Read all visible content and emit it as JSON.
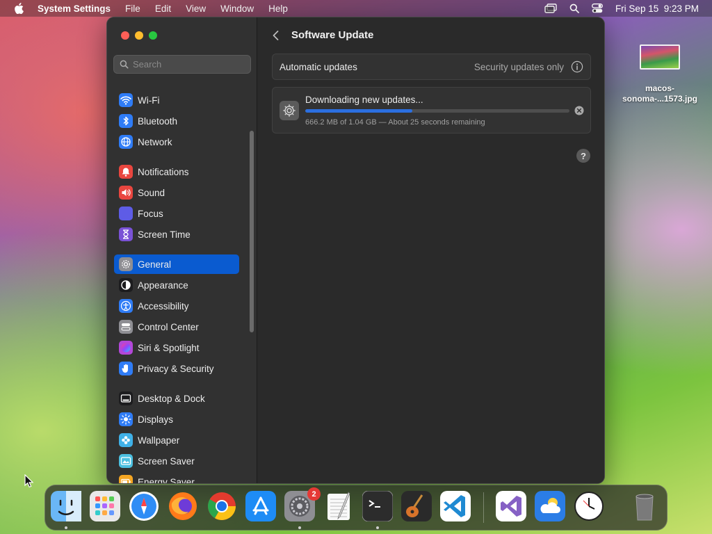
{
  "menubar": {
    "app_name": "System Settings",
    "items": [
      "File",
      "Edit",
      "View",
      "Window",
      "Help"
    ],
    "datetime": "Fri Sep 15  9:23 PM"
  },
  "sidebar": {
    "search_placeholder": "Search",
    "items": [
      {
        "label": "Wi-Fi",
        "icon": "wifi-icon",
        "color": "#2f7cf6"
      },
      {
        "label": "Bluetooth",
        "icon": "bluetooth-icon",
        "color": "#2f7cf6"
      },
      {
        "label": "Network",
        "icon": "globe-icon",
        "color": "#2f7cf6"
      },
      {
        "label": "Notifications",
        "icon": "bell-icon",
        "color": "#e9463f"
      },
      {
        "label": "Sound",
        "icon": "speaker-icon",
        "color": "#e9463f"
      },
      {
        "label": "Focus",
        "icon": "moon-icon",
        "color": "#5e5ce6"
      },
      {
        "label": "Screen Time",
        "icon": "hourglass-icon",
        "color": "#7a52d6"
      },
      {
        "label": "General",
        "icon": "gear-icon",
        "color": "#8e8e93",
        "active": true
      },
      {
        "label": "Appearance",
        "icon": "appearance-icon",
        "color": "#1c1c1e"
      },
      {
        "label": "Accessibility",
        "icon": "accessibility-icon",
        "color": "#2f7cf6"
      },
      {
        "label": "Control Center",
        "icon": "toggles-icon",
        "color": "#8e8e93"
      },
      {
        "label": "Siri & Spotlight",
        "icon": "siri-icon",
        "color": "#b347d9"
      },
      {
        "label": "Privacy & Security",
        "icon": "hand-icon",
        "color": "#2f7cf6"
      },
      {
        "label": "Desktop & Dock",
        "icon": "dock-icon",
        "color": "#1c1c1e"
      },
      {
        "label": "Displays",
        "icon": "sun-icon",
        "color": "#2f7cf6"
      },
      {
        "label": "Wallpaper",
        "icon": "flower-icon",
        "color": "#3fb1e8"
      },
      {
        "label": "Screen Saver",
        "icon": "screensaver-icon",
        "color": "#4cc0e0"
      },
      {
        "label": "Energy Saver",
        "icon": "battery-icon",
        "color": "#f5a623"
      }
    ]
  },
  "content": {
    "title": "Software Update",
    "automatic_updates": {
      "label": "Automatic updates",
      "value": "Security updates only"
    },
    "download": {
      "title": "Downloading new updates...",
      "progress_fraction": 0.405,
      "status": "666.2 MB of 1.04 GB — About 25 seconds remaining"
    },
    "help_label": "?"
  },
  "desktop": {
    "file_name_line1": "macos-",
    "file_name_line2": "sonoma-...1573.jpg"
  },
  "dock": {
    "apps": [
      {
        "name": "finder-icon",
        "color": "#3a8ef0",
        "running": true
      },
      {
        "name": "launchpad-icon",
        "color": "#e9e9e9",
        "running": false
      },
      {
        "name": "safari-icon",
        "color": "#2f8df5",
        "running": false
      },
      {
        "name": "firefox-icon",
        "color": "#ff7a1a",
        "running": false
      },
      {
        "name": "chrome-icon",
        "color": "#ffffff",
        "running": false
      },
      {
        "name": "app-store-icon",
        "color": "#1e8cf5",
        "running": false
      },
      {
        "name": "system-settings-icon",
        "color": "#8e8e93",
        "running": true,
        "badge": "2"
      },
      {
        "name": "textedit-icon",
        "color": "#f4f4f4",
        "running": false
      },
      {
        "name": "terminal-icon",
        "color": "#1e1e1e",
        "running": true
      },
      {
        "name": "garageband-icon",
        "color": "#2a2a2a",
        "running": false
      },
      {
        "name": "vscode-icon",
        "color": "#ffffff",
        "running": false
      },
      {
        "name": "visual-studio-icon",
        "color": "#ffffff",
        "running": false
      },
      {
        "name": "weather-icon",
        "color": "#2b7de6",
        "running": false
      },
      {
        "name": "clock-icon",
        "color": "#ffffff",
        "running": false
      },
      {
        "name": "trash-icon",
        "color": "#6f6f6f",
        "running": false
      }
    ]
  }
}
